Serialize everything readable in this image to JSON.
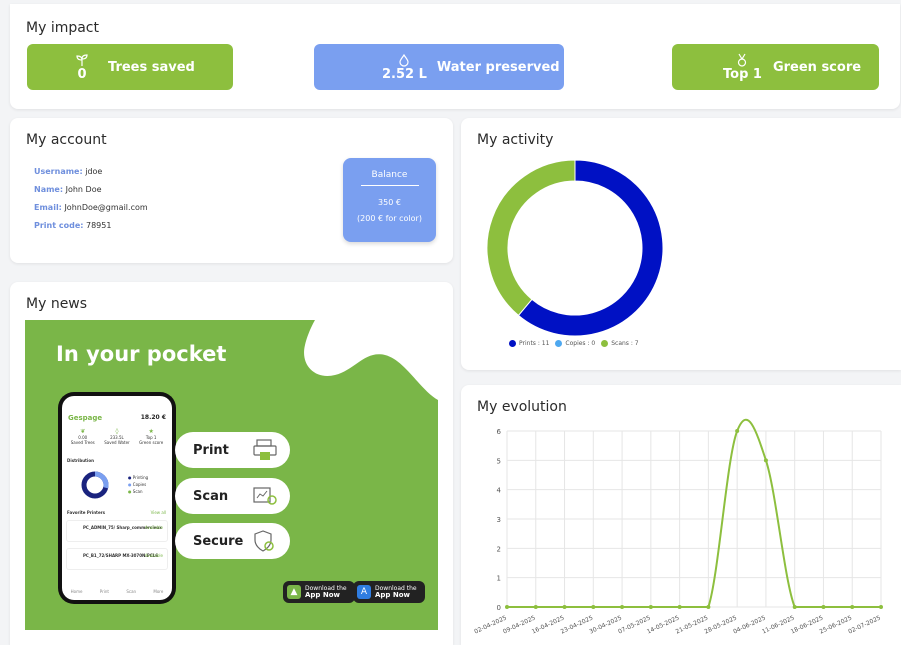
{
  "impact": {
    "title": "My impact",
    "trees": {
      "value": "0",
      "label": "Trees saved",
      "icon": "sprout-icon"
    },
    "water": {
      "value": "2.52 L",
      "label": "Water preserved",
      "icon": "droplet-icon"
    },
    "score": {
      "value": "Top 1",
      "label": "Green score",
      "icon": "medal-icon"
    }
  },
  "account": {
    "title": "My account",
    "username_label": "Username:",
    "username": "jdoe",
    "name_label": "Name:",
    "name": "John Doe",
    "email_label": "Email:",
    "email": "JohnDoe@gmail.com",
    "printcode_label": "Print code:",
    "printcode": "78951",
    "balance_title": "Balance",
    "balance_amount": "350 €",
    "balance_color": "(200 € for color)"
  },
  "activity": {
    "title": "My activity",
    "legend": [
      {
        "label": "Prints : 11",
        "color": "#0011c4"
      },
      {
        "label": "Copies : 0",
        "color": "#4ea8f0"
      },
      {
        "label": "Scans : 7",
        "color": "#8dbf3e"
      }
    ]
  },
  "news": {
    "title": "My news",
    "headline": "In your pocket",
    "pills": [
      "Print",
      "Scan",
      "Secure"
    ],
    "android": {
      "top": "ANDROID",
      "sub": "Download the",
      "main": "App Now"
    },
    "ios": {
      "top": "iOS",
      "sub": "Download the",
      "main": "App Now"
    },
    "phone": {
      "brand": "Gespage",
      "balance": "18.20 €",
      "stats": [
        "0.00",
        "233.5L",
        "Top 1"
      ],
      "stat_labels": [
        "Saved Trees",
        "Saved Water",
        "Green score"
      ],
      "distribution": "Distribution",
      "dist_legend": [
        "Printing",
        "Copies",
        "Scan"
      ],
      "favorites": "Favorite Printers",
      "view_all": "View all",
      "printers": [
        {
          "name": "PC_ADMIN_75/ Sharp_commercieux",
          "status": "Available"
        },
        {
          "name": "PC_B1_72/SHARP MX-3070N.PCL6",
          "status": "Available"
        }
      ],
      "tabs": [
        "Home",
        "Print",
        "Scan",
        "More"
      ]
    }
  },
  "evolution": {
    "title": "My evolution"
  },
  "chart_data": [
    {
      "type": "pie",
      "title": "",
      "categories": [
        "Prints",
        "Copies",
        "Scans"
      ],
      "values": [
        11,
        0,
        7
      ],
      "colors": [
        "#0011c4",
        "#4ea8f0",
        "#8dbf3e"
      ],
      "legend": "bottom"
    },
    {
      "type": "line",
      "title": "",
      "x": [
        "02-04-2025",
        "09-04-2025",
        "16-04-2025",
        "23-04-2025",
        "30-04-2025",
        "07-05-2025",
        "14-05-2025",
        "21-05-2025",
        "28-05-2025",
        "04-06-2025",
        "11-06-2025",
        "18-06-2025",
        "25-06-2025",
        "02-07-2025"
      ],
      "series": [
        {
          "values": [
            0,
            0,
            0,
            0,
            0,
            0,
            0,
            0,
            6,
            5,
            0,
            0,
            0,
            0
          ]
        }
      ],
      "ylim": [
        0,
        6
      ],
      "yticks": [
        0,
        1,
        2,
        3,
        4,
        5,
        6
      ],
      "color": "#8dbf3e",
      "grid": true
    }
  ]
}
